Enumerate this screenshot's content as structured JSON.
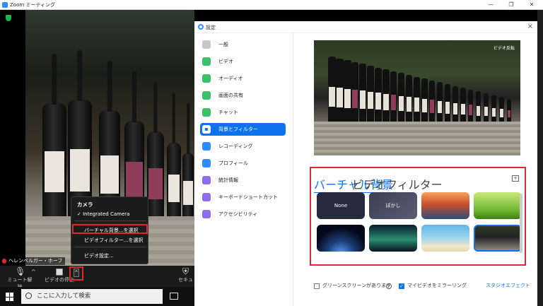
{
  "window": {
    "title": "Zoom ミーティング",
    "controls": {
      "minimize": "—",
      "restore": "❐",
      "close": "✕"
    }
  },
  "video": {
    "participant_name": "ヘレンベルガー・ホーフ"
  },
  "camera_menu": {
    "header": "カメラ",
    "camera_name": "Integrated Camera",
    "items": [
      "バーチャル背景...を選択",
      "ビデオフィルター...を選択",
      "ビデオ設定..."
    ]
  },
  "toolbar": {
    "mute_label": "ミュート解除",
    "video_label": "ビデオの停止",
    "security_label": "セキュ"
  },
  "taskbar": {
    "search_placeholder": "ここに入力して検索"
  },
  "settings": {
    "title": "設定",
    "nav": [
      {
        "label": "一般",
        "icon": "gear-icon",
        "color": "#c8c8c8"
      },
      {
        "label": "ビデオ",
        "icon": "video-icon",
        "color": "#3cc069"
      },
      {
        "label": "オーディオ",
        "icon": "headphone-icon",
        "color": "#3cc069"
      },
      {
        "label": "画面の共有",
        "icon": "share-screen-icon",
        "color": "#3cc069"
      },
      {
        "label": "チャット",
        "icon": "chat-icon",
        "color": "#3cc069"
      },
      {
        "label": "背景とフィルター",
        "icon": "background-icon",
        "color": "#ffffff"
      },
      {
        "label": "レコーディング",
        "icon": "record-icon",
        "color": "#2d8cff"
      },
      {
        "label": "プロフィール",
        "icon": "profile-icon",
        "color": "#2d8cff"
      },
      {
        "label": "統計情報",
        "icon": "stats-icon",
        "color": "#8f6ee8"
      },
      {
        "label": "キーボードショートカット",
        "icon": "keyboard-icon",
        "color": "#8f6ee8"
      },
      {
        "label": "アクセシビリティ",
        "icon": "accessibility-icon",
        "color": "#8f6ee8"
      }
    ],
    "preview_mirror": "ビデオ反転",
    "tabs": [
      "バーチャル背景",
      "ビデオフィルター"
    ],
    "thumbnails": [
      {
        "label": "None",
        "kind": "none"
      },
      {
        "label": "ぼかし",
        "kind": "blur"
      },
      {
        "label": "",
        "kind": "bridge"
      },
      {
        "label": "",
        "kind": "grass"
      },
      {
        "label": "",
        "kind": "earth"
      },
      {
        "label": "",
        "kind": "aurora"
      },
      {
        "label": "",
        "kind": "beach"
      },
      {
        "label": "",
        "kind": "custom"
      }
    ],
    "greenscreen_label": "グリーンスクリーンがあります",
    "mirror_label": "マイビデオをミラーリング",
    "studio_label": "スタジオエフェクト"
  }
}
